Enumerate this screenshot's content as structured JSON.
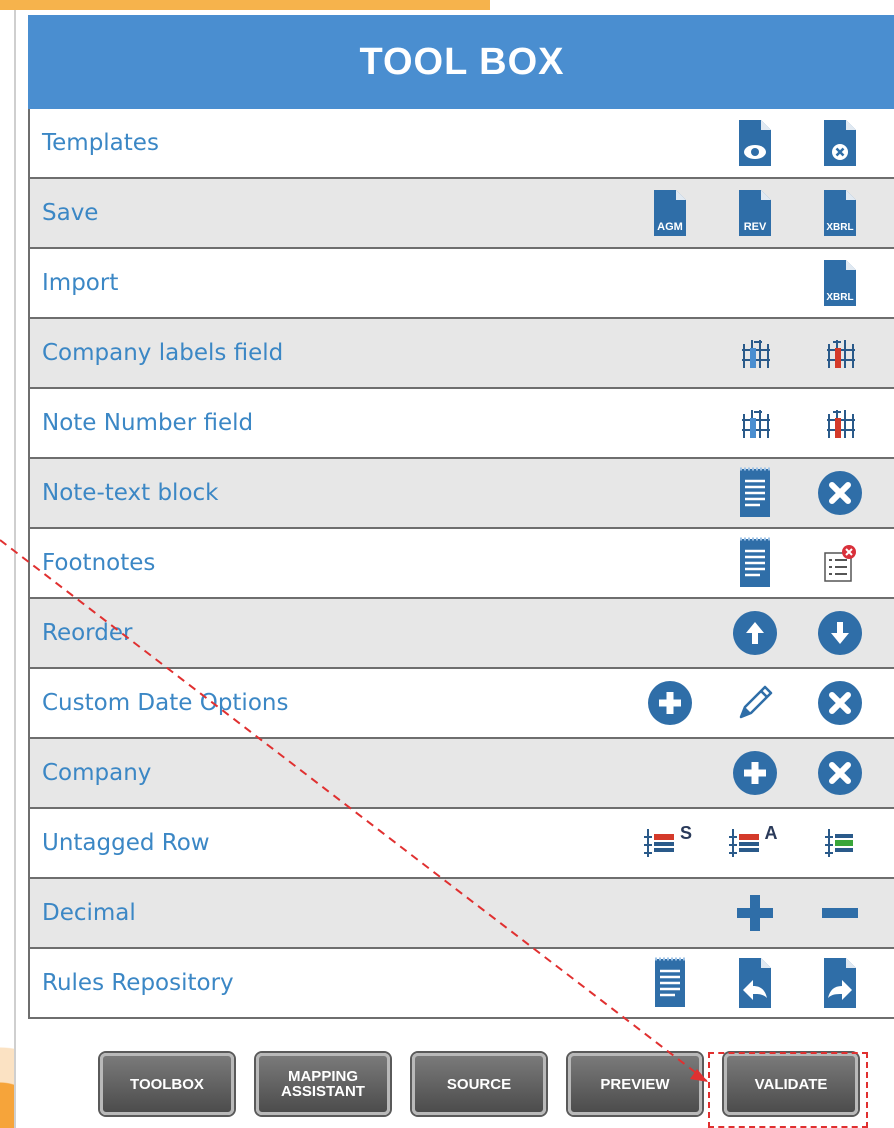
{
  "toolbox": {
    "title": "TOOL BOX",
    "rows": [
      {
        "label": "Templates",
        "icons": [
          "view-template-icon",
          "delete-template-icon"
        ]
      },
      {
        "label": "Save",
        "icons": [
          "save-agm-icon",
          "save-rev-icon",
          "save-xbrl-icon"
        ],
        "icon_texts": [
          "AGM",
          "REV",
          "XBRL"
        ]
      },
      {
        "label": "Import",
        "icons": [
          "import-xbrl-icon"
        ],
        "icon_texts": [
          "XBRL"
        ]
      },
      {
        "label": "Company labels field",
        "icons": [
          "add-column-blue-icon",
          "add-column-red-icon"
        ]
      },
      {
        "label": "Note Number field",
        "icons": [
          "add-column-blue-icon",
          "add-column-red-icon"
        ]
      },
      {
        "label": "Note-text block",
        "icons": [
          "document-text-icon",
          "remove-circle-icon"
        ]
      },
      {
        "label": "Footnotes",
        "icons": [
          "document-text-icon",
          "remove-list-icon"
        ]
      },
      {
        "label": "Reorder",
        "icons": [
          "arrow-up-circle-icon",
          "arrow-down-circle-icon"
        ]
      },
      {
        "label": "Custom Date Options",
        "icons": [
          "add-circle-icon",
          "pencil-icon",
          "remove-circle-icon"
        ]
      },
      {
        "label": "Company",
        "icons": [
          "add-circle-icon",
          "remove-circle-icon"
        ]
      },
      {
        "label": "Untagged Row",
        "icons": [
          "untagged-s-icon",
          "untagged-a-icon",
          "untagged-green-icon"
        ],
        "icon_texts": [
          "S",
          "A"
        ]
      },
      {
        "label": "Decimal",
        "icons": [
          "plus-icon",
          "minus-icon"
        ]
      },
      {
        "label": "Rules Repository",
        "icons": [
          "document-text-icon",
          "undo-document-icon",
          "redo-document-icon"
        ]
      }
    ]
  },
  "footer": {
    "buttons": [
      {
        "label": "TOOLBOX"
      },
      {
        "label": "MAPPING ASSISTANT"
      },
      {
        "label": "SOURCE"
      },
      {
        "label": "PREVIEW"
      },
      {
        "label": "VALIDATE"
      }
    ]
  },
  "colors": {
    "header": "#4a8ed0",
    "label": "#3b87c5",
    "icon_blue": "#2f6ea8",
    "annotation_red": "#e03030"
  }
}
